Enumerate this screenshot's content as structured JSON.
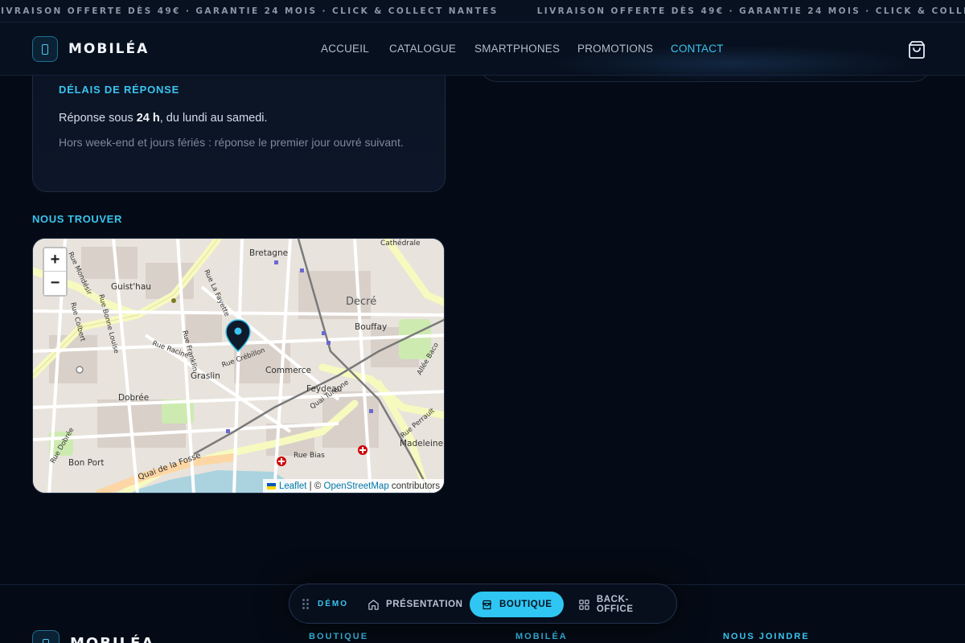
{
  "marquee": {
    "text": "LIVRAISON OFFERTE DÈS 49€ · GARANTIE 24 MOIS · CLICK & COLLECT NANTES"
  },
  "header": {
    "brand": "MOBILÉA",
    "nav": [
      {
        "label": "ACCUEIL"
      },
      {
        "label": "CATALOGUE"
      },
      {
        "label": "SMARTPHONES"
      },
      {
        "label": "PROMOTIONS"
      },
      {
        "label": "CONTACT",
        "active": true
      }
    ],
    "cart_icon": "shopping-bag-icon"
  },
  "response_card": {
    "title": "DÉLAIS DE RÉPONSE",
    "line_prefix": "Réponse sous ",
    "line_strong": "24 h",
    "line_suffix": ", du lundi au samedi.",
    "hint": "Hors week-end et jours fériés : réponse le premier jour ouvré suivant."
  },
  "map_section": {
    "title": "NOUS TROUVER",
    "zoom_in": "+",
    "zoom_out": "−",
    "attribution": {
      "leaflet": "Leaflet",
      "separator": " | © ",
      "osm": "OpenStreetMap",
      "suffix": " contributors"
    },
    "labels": {
      "bretagne": "Bretagne",
      "decre": "Decré",
      "bouffay": "Bouffay",
      "guisthau": "Guist'hau",
      "graslin": "Graslin",
      "commerce": "Commerce",
      "feydeau": "Feydeau",
      "dobree": "Dobrée",
      "bon_port": "Bon Port",
      "madeleine": "Madeleine",
      "quai_fosse": "Quai de la Fosse",
      "rue_bias": "Rue Bias",
      "rue_racine": "Rue Racine",
      "rue_franklin": "Rue Franklin",
      "rue_lafayette": "Rue La Fayette",
      "quai_turenne": "Quai Turenne",
      "rue_perrault": "Rue Perrault",
      "rue_dobree": "Rue Dobrée",
      "rue_colbert": "Rue Colbert",
      "rue_bonne_louise": "Rue Bonne Louise",
      "rue_mondesir": "Rue Mondésir",
      "allee_baco": "Allée Baco",
      "rue_crebillon": "Rue Crébillon",
      "cathedrale": "Cathédrale"
    }
  },
  "demo_bar": {
    "label": "DÉMO",
    "tabs": [
      {
        "label": "PRÉSENTATION",
        "icon": "home-icon"
      },
      {
        "label": "BOUTIQUE",
        "icon": "store-icon",
        "active": true
      },
      {
        "label": "BACK-OFFICE",
        "icon": "dashboard-icon"
      }
    ]
  },
  "footer": {
    "brand": "MOBILÉA",
    "columns": [
      "BOUTIQUE",
      "MOBILÉA",
      "NOUS JOINDRE"
    ]
  },
  "colors": {
    "accent": "#3ac4ef",
    "background": "#050b16",
    "pin": "#0f1a2b"
  }
}
